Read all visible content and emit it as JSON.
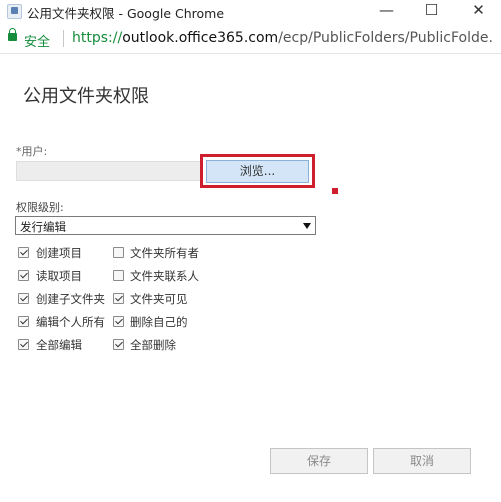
{
  "window": {
    "title": "公用文件夹权限 - Google Chrome",
    "minimize_glyph": "—",
    "maximize_glyph": "☐",
    "close_glyph": "✕"
  },
  "addressbar": {
    "secure_label": "安全",
    "url_protocol": "https://",
    "url_host": "outlook.office365.com",
    "url_path": "/ecp/PublicFolders/PublicFolde..."
  },
  "dialog": {
    "title": "公用文件夹权限",
    "user_label": "*用户:",
    "user_value": "",
    "browse_label": "浏览...",
    "level_label": "权限级别:",
    "level_value": "发行编辑",
    "permissions": [
      {
        "label": "创建项目",
        "checked": true
      },
      {
        "label": "文件夹所有者",
        "checked": false
      },
      {
        "label": "读取项目",
        "checked": true
      },
      {
        "label": "文件夹联系人",
        "checked": false
      },
      {
        "label": "创建子文件夹",
        "checked": true
      },
      {
        "label": "文件夹可见",
        "checked": true
      },
      {
        "label": "编辑个人所有",
        "checked": true
      },
      {
        "label": "删除自己的",
        "checked": true
      },
      {
        "label": "全部编辑",
        "checked": true
      },
      {
        "label": "全部删除",
        "checked": true
      }
    ],
    "save_label": "保存",
    "cancel_label": "取消"
  },
  "colors": {
    "highlight_box": "#cf1f2e",
    "secure_green": "#168c3c",
    "browse_button_bg": "#d3e5f6"
  }
}
